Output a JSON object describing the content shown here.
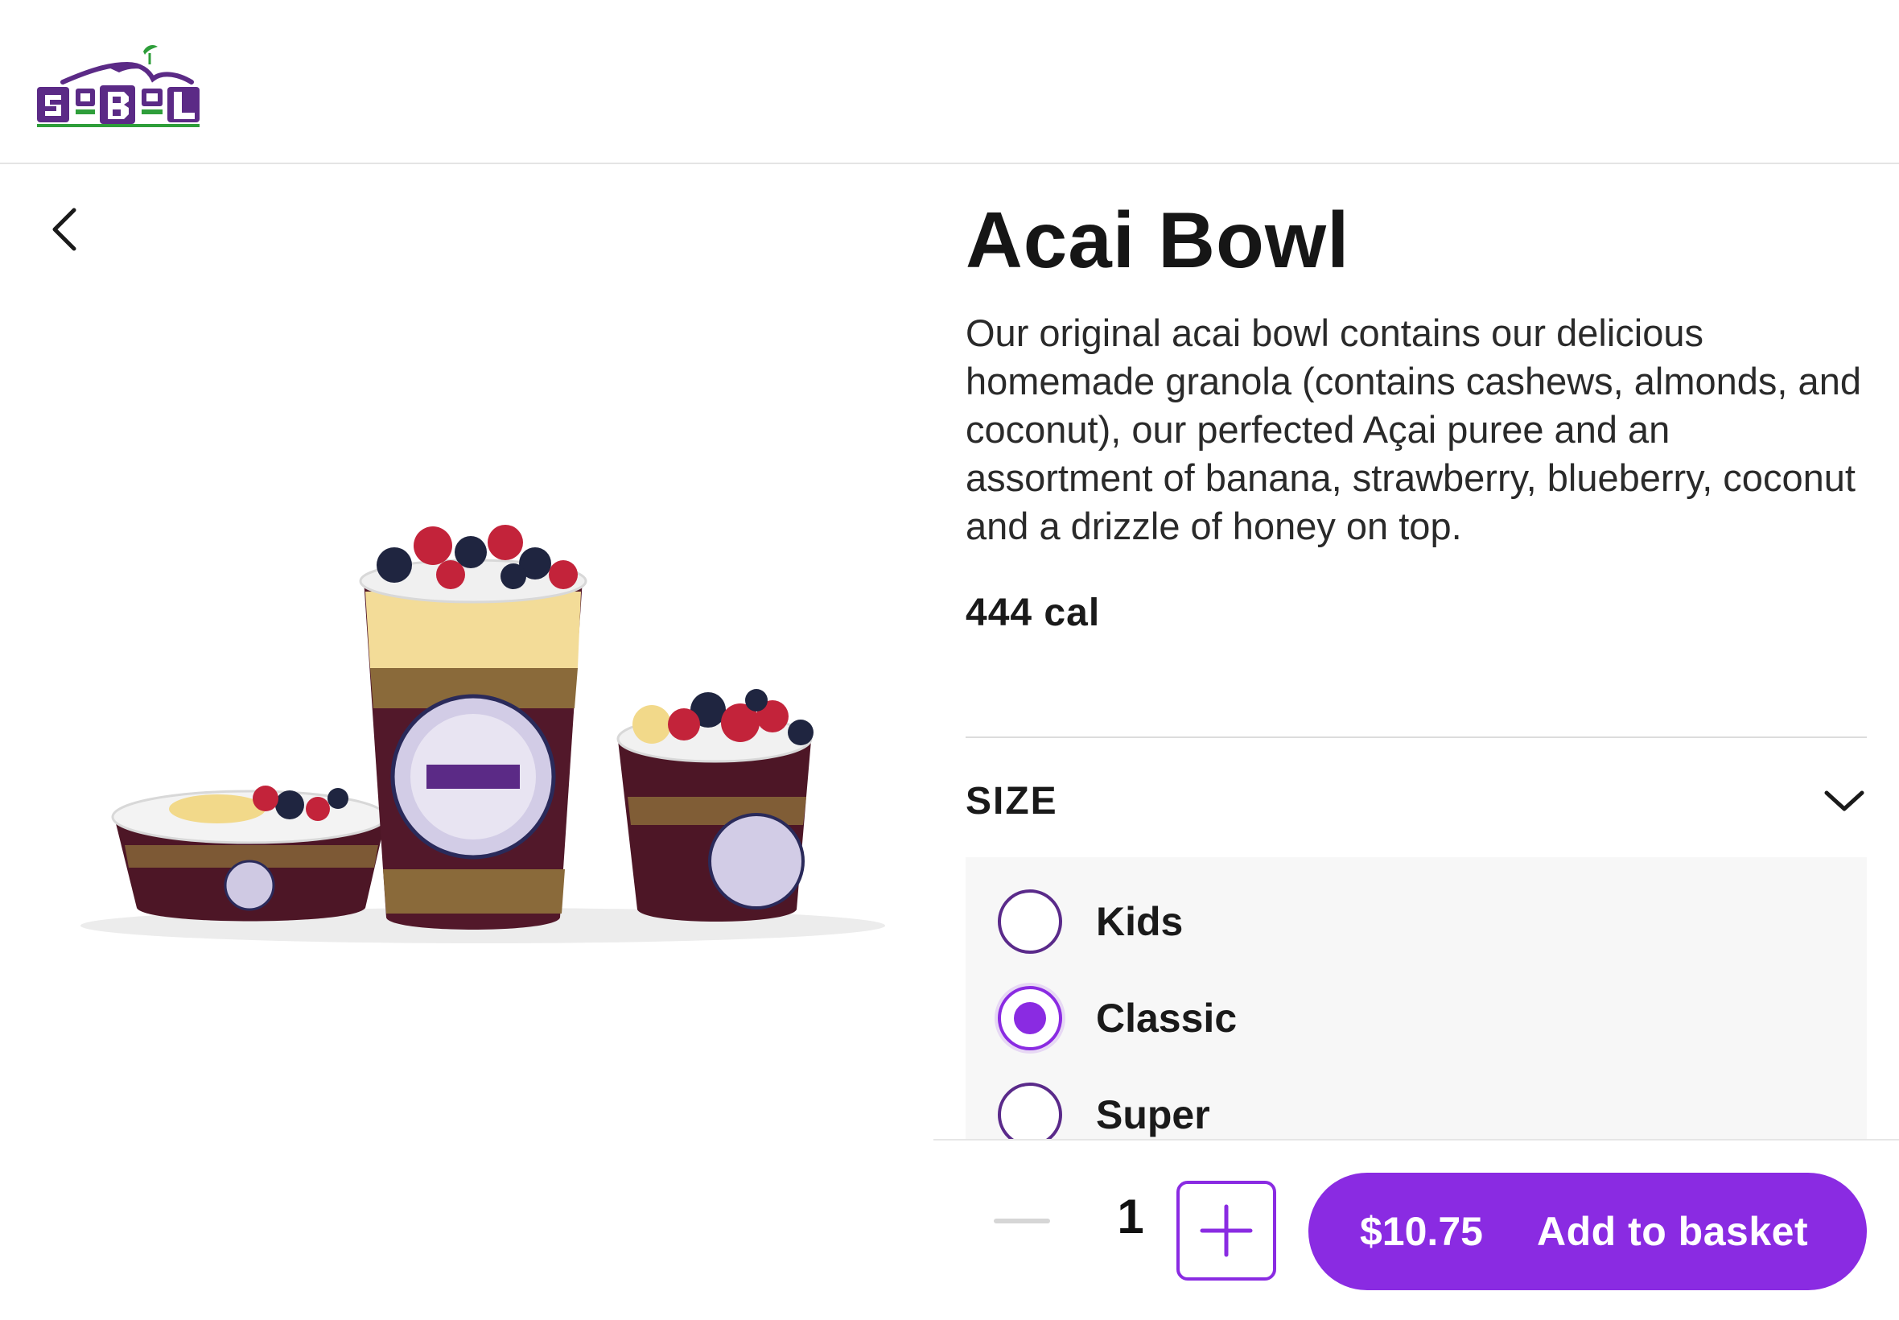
{
  "header": {
    "logo_text": "SoBol"
  },
  "product": {
    "title": "Acai Bowl",
    "description": "Our original acai bowl contains our delicious homemade granola (contains cashews, almonds, and coconut), our perfected Açai puree and an assortment of banana, strawberry, blueberry, coconut and a drizzle of honey on top.",
    "calories": "444  cal",
    "image_alt": "Three acai bowls in kids, classic and super sizes"
  },
  "size_section": {
    "label": "SIZE",
    "options": [
      {
        "label": "Kids",
        "selected": false
      },
      {
        "label": "Classic",
        "selected": true
      },
      {
        "label": "Super",
        "selected": false
      }
    ]
  },
  "footer": {
    "quantity": "1",
    "price": "$10.75",
    "add_label": "Add to basket"
  },
  "colors": {
    "accent": "#8a2be2",
    "brand_purple": "#5b2a86",
    "brand_green": "#2e9e3a"
  },
  "icons": {
    "back": "chevron-left-icon",
    "expand": "chevron-down-icon",
    "minus": "minus-icon",
    "plus": "plus-icon"
  }
}
